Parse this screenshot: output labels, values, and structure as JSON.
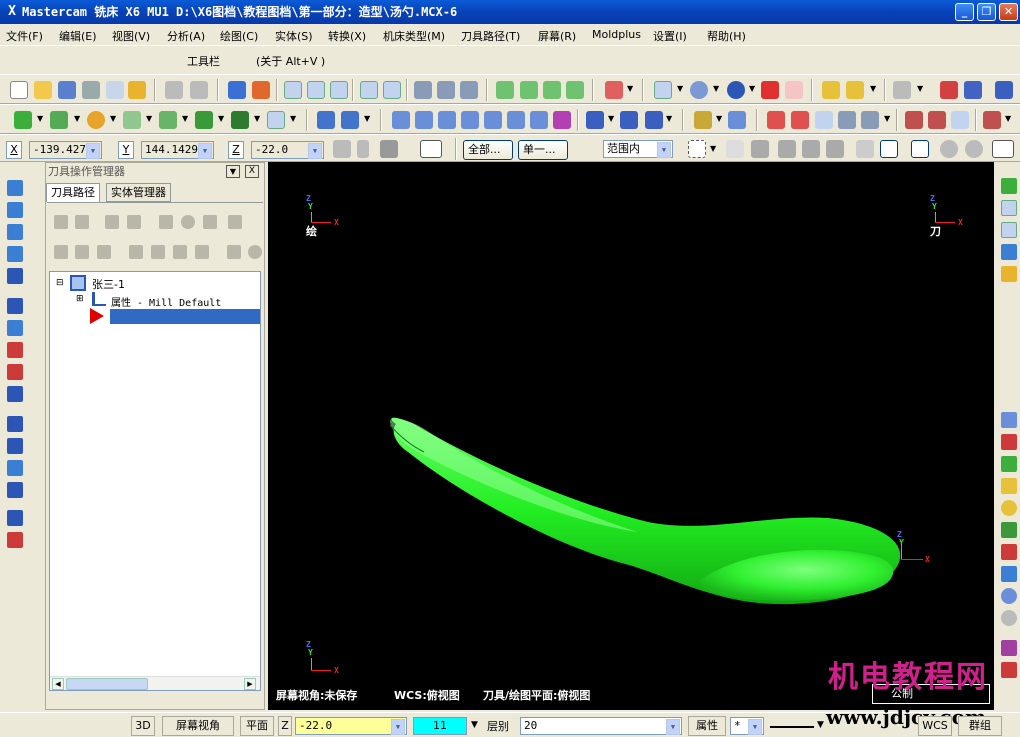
{
  "window": {
    "app_glyph": "X",
    "title": "Mastercam 铣床 X6 MU1  D:\\X6图档\\教程图档\\第一部分：造型\\汤勺.MCX-6",
    "minimize": "_",
    "restore": "❐",
    "close": "✕"
  },
  "menu": {
    "items": [
      {
        "label": "文件(F)"
      },
      {
        "label": "编辑(E)"
      },
      {
        "label": "视图(V)"
      },
      {
        "label": "分析(A)"
      },
      {
        "label": "绘图(C)"
      },
      {
        "label": "实体(S)"
      },
      {
        "label": "转换(X)"
      },
      {
        "label": "机床类型(M)"
      },
      {
        "label": "刀具路径(T)"
      },
      {
        "label": "屏幕(R)"
      },
      {
        "label": "Moldplus"
      },
      {
        "label": "设置(I)"
      },
      {
        "label": "帮助(H)"
      }
    ],
    "row2": [
      {
        "label": "工具栏"
      },
      {
        "label": "(关于 Alt+V )"
      }
    ]
  },
  "coords": {
    "x_label": "X",
    "x_value": "-139.427",
    "y_label": "Y",
    "y_value": "144.1429",
    "z_label": "Z",
    "z_value": "-22.0",
    "btn_all": "全部...",
    "btn_single": "单一...",
    "range_select": "范围内"
  },
  "panel": {
    "title": "刀具操作管理器",
    "close": "X",
    "tabs": [
      {
        "label": "刀具路径"
      },
      {
        "label": "实体管理器"
      }
    ],
    "tree": {
      "root": "张三-1",
      "child": "属性 - Mill Default",
      "expander": "⊟",
      "expander_child": "⊞"
    }
  },
  "viewport": {
    "gview_label": "绘",
    "tplane_label": "刀",
    "axis_x": "X",
    "axis_y": "Y",
    "axis_z": "Z",
    "status_view": "屏幕视角:未保存",
    "status_wcs": "WCS:俯视图",
    "status_plane": "刀具/绘图平面:俯视图",
    "units": "公制",
    "watermark_cn": "机电教程网",
    "watermark_url": "www.jdjcy.com",
    "part_color": "#22ee22"
  },
  "statusbar": {
    "btn_3d": "3D",
    "btn_gview": "屏幕视角",
    "btn_plane": "平面",
    "z_label": "Z",
    "z_value": "-22.0",
    "color_value": "11",
    "level_label": "层别",
    "level_value": "20",
    "attrib_label": "属性",
    "group_label": "群组",
    "wcs_label": "WCS",
    "linestyle": "*"
  },
  "colors": {
    "title_bg": "#0842b8",
    "viewport_bg": "#000000",
    "selected_row": "#316ac5",
    "z_field_bg": "#ffff99",
    "color_field_bg": "#00ffff"
  }
}
